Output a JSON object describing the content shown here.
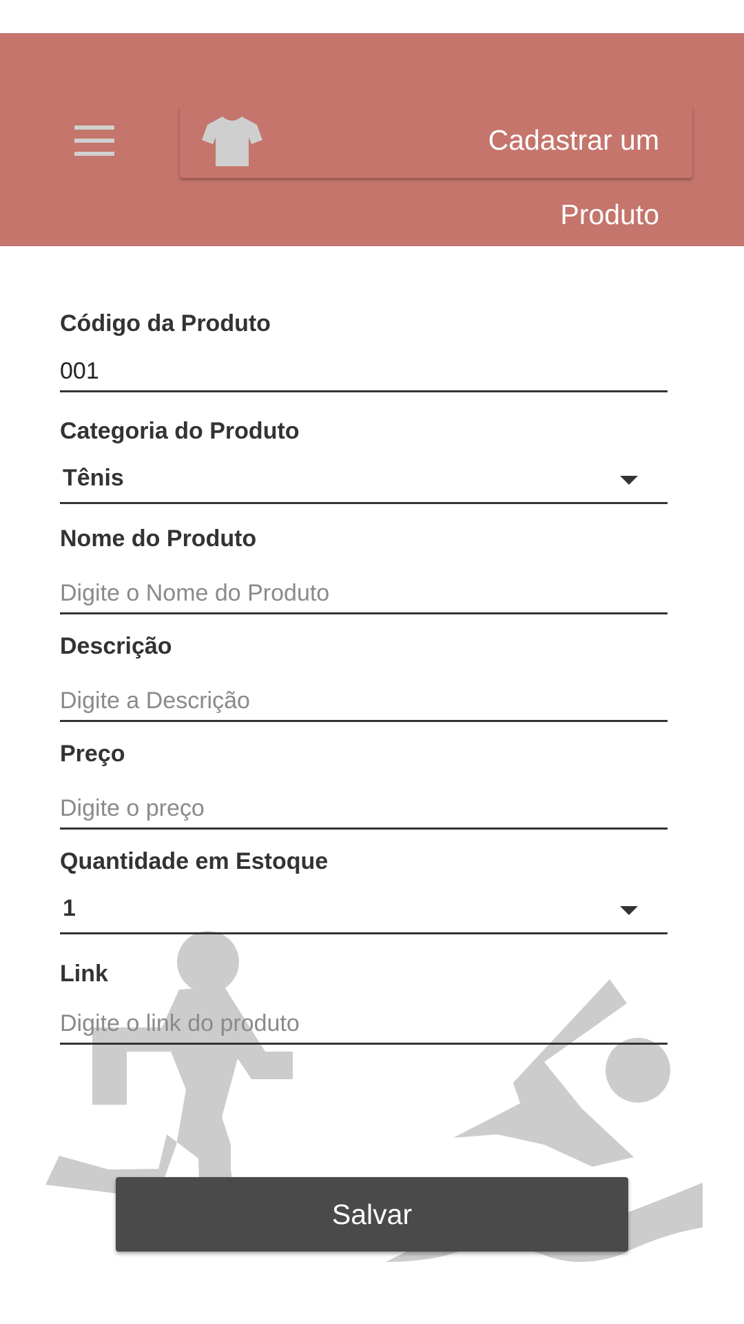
{
  "header": {
    "title_line1": "Cadastrar um",
    "title_line2": "Produto",
    "menu_icon": "hamburger-menu-icon",
    "product_icon": "t-shirt-icon",
    "background_color": "#c5756c"
  },
  "form": {
    "codigo": {
      "label": "Código da Produto",
      "value": "001"
    },
    "categoria": {
      "label": "Categoria do Produto",
      "selected": "Tênis"
    },
    "nome": {
      "label": "Nome do Produto",
      "placeholder": "Digite o Nome do Produto"
    },
    "descricao": {
      "label": "Descrição",
      "placeholder": "Digite a Descrição"
    },
    "preco": {
      "label": "Preço",
      "placeholder": "Digite o preço"
    },
    "quantidade": {
      "label": "Quantidade em Estoque",
      "selected": "1"
    },
    "link": {
      "label": "Link",
      "placeholder": "Digite o link do produto"
    }
  },
  "actions": {
    "save_label": "Salvar",
    "button_color": "#4a4a4a"
  },
  "background": {
    "icons": [
      "running-person-icon",
      "swimming-person-icon"
    ],
    "color": "#cccccc"
  }
}
